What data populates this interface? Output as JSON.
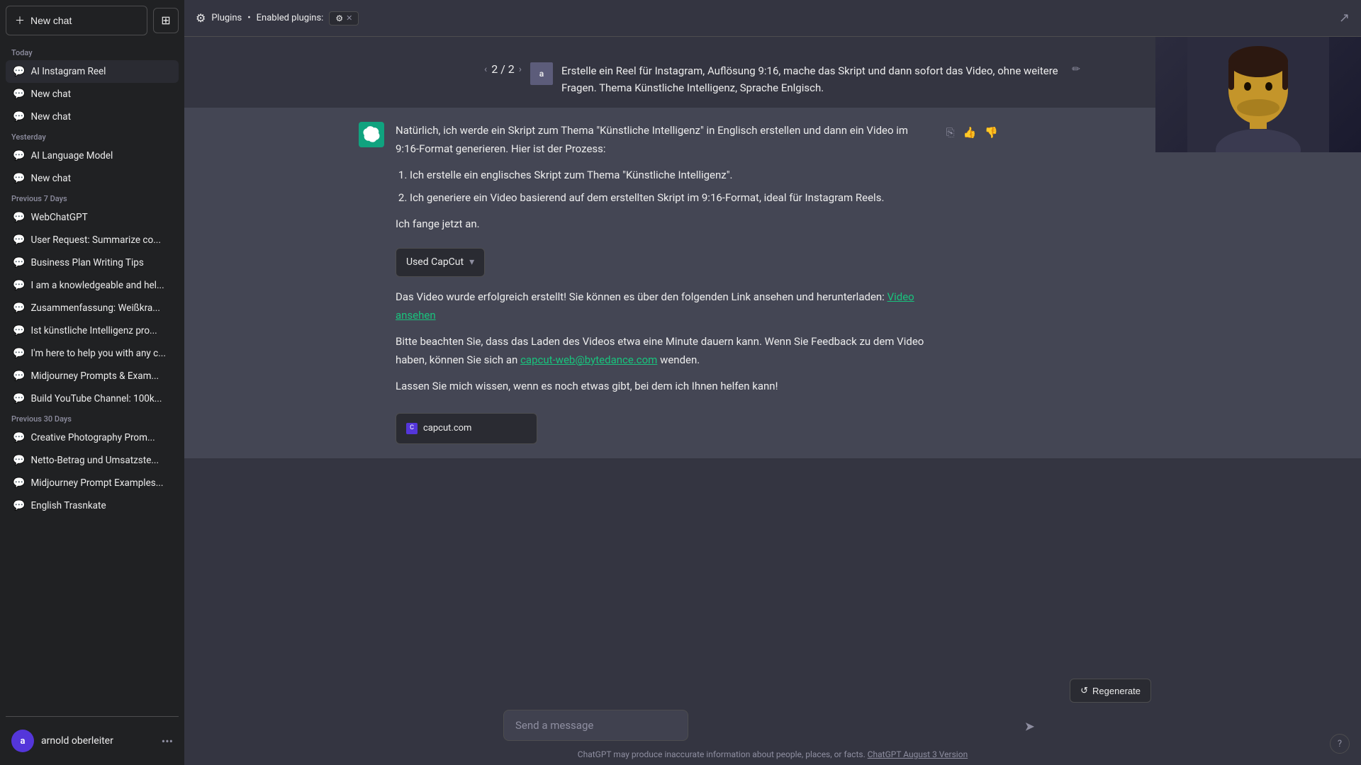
{
  "app": {
    "title": "ChatGPT"
  },
  "sidebar": {
    "new_chat_label": "New chat",
    "sections": [
      {
        "label": "Today",
        "items": [
          {
            "id": "ai-instagram-reel",
            "text": "AI Instagram Reel",
            "active": true
          }
        ]
      },
      {
        "label": "Yesterday",
        "items": [
          {
            "id": "ai-language-model",
            "text": "AI Language Model",
            "active": false
          },
          {
            "id": "new-chat-2",
            "text": "New chat",
            "active": false
          }
        ]
      },
      {
        "label": "Previous 7 Days",
        "items": [
          {
            "id": "webchatgpt",
            "text": "WebChatGPT",
            "active": false
          },
          {
            "id": "user-request-summarize",
            "text": "User Request: Summarize co...",
            "active": false
          },
          {
            "id": "business-plan",
            "text": "Business Plan Writing Tips",
            "active": false
          },
          {
            "id": "knowledgeable",
            "text": "I am a knowledgeable and hel...",
            "active": false
          },
          {
            "id": "zusammenfassung",
            "text": "Zusammenfassung: Weißkra...",
            "active": false
          },
          {
            "id": "kunstliche",
            "text": "Ist künstliche Intelligenz pro...",
            "active": false
          },
          {
            "id": "im-here",
            "text": "I'm here to help you with any c...",
            "active": false
          },
          {
            "id": "midjourney",
            "text": "Midjourney Prompts & Exam...",
            "active": false
          },
          {
            "id": "build-youtube",
            "text": "Build YouTube Channel: 100k...",
            "active": false
          }
        ]
      },
      {
        "label": "Previous 30 Days",
        "items": [
          {
            "id": "creative-photography",
            "text": "Creative Photography Prom...",
            "active": false
          },
          {
            "id": "netto-betrag",
            "text": "Netto-Betrag und Umsatzste...",
            "active": false
          },
          {
            "id": "midjourney-prompt",
            "text": "Midjourney Prompt Examples...",
            "active": false
          },
          {
            "id": "english-transkate",
            "text": "English Trasnkate",
            "active": false
          }
        ]
      }
    ],
    "today_new_chats": [
      {
        "id": "new-chat-today-1",
        "text": "New chat"
      },
      {
        "id": "new-chat-today-2",
        "text": "New chat"
      }
    ],
    "user": {
      "name": "arnold oberleiter",
      "avatar_letter": "a"
    }
  },
  "topbar": {
    "plugins_label": "Plugins",
    "dot_separator": "•",
    "enabled_plugins_label": "Enabled plugins:",
    "enabled_plugin_name": "⚙"
  },
  "conversation": {
    "nav": {
      "prev": "‹",
      "next": "›",
      "current": "2",
      "total": "2",
      "display": "2 / 2"
    },
    "user_message": "Erstelle ein Reel für Instagram, Auflösung 9:16, mache das Skript und dann sofort das Video, ohne weitere Fragen. Thema Künstliche Intelligenz, Sprache Enlgisch.",
    "user_avatar": "a",
    "ai_response": {
      "intro": "Natürlich, ich werde ein Skript zum Thema \"Künstliche Intelligenz\" in Englisch erstellen und dann ein Video im 9:16-Format generieren. Hier ist der Prozess:",
      "steps": [
        "Ich erstelle ein englisches Skript zum Thema \"Künstliche Intelligenz\".",
        "Ich generiere ein Video basierend auf dem erstellten Skript im 9:16-Format, ideal für Instagram Reels."
      ],
      "starting": "Ich fange jetzt an.",
      "plugin_used": "Used CapCut",
      "success_text": "Das Video wurde erfolgreich erstellt! Sie können es über den folgenden Link ansehen und herunterladen:",
      "video_link_text": "Video ansehen",
      "loading_note": "Bitte beachten Sie, dass das Laden des Videos etwa eine Minute dauern kann. Wenn Sie Feedback zu dem Video haben, können Sie sich an",
      "email_link": "capcut-web@bytedance.com",
      "loading_note_end": "wenden.",
      "closing": "Lassen Sie mich wissen, wenn es noch etwas gibt, bei dem ich Ihnen helfen kann!",
      "source_url": "capcut.com"
    }
  },
  "bottom": {
    "regenerate_label": "↺ Regenerate",
    "input_placeholder": "Send a message",
    "send_icon": "➤",
    "footer_note": "ChatGPT may produce inaccurate information about people, places, or facts.",
    "footer_link": "ChatGPT August 3 Version",
    "help_icon": "?"
  }
}
